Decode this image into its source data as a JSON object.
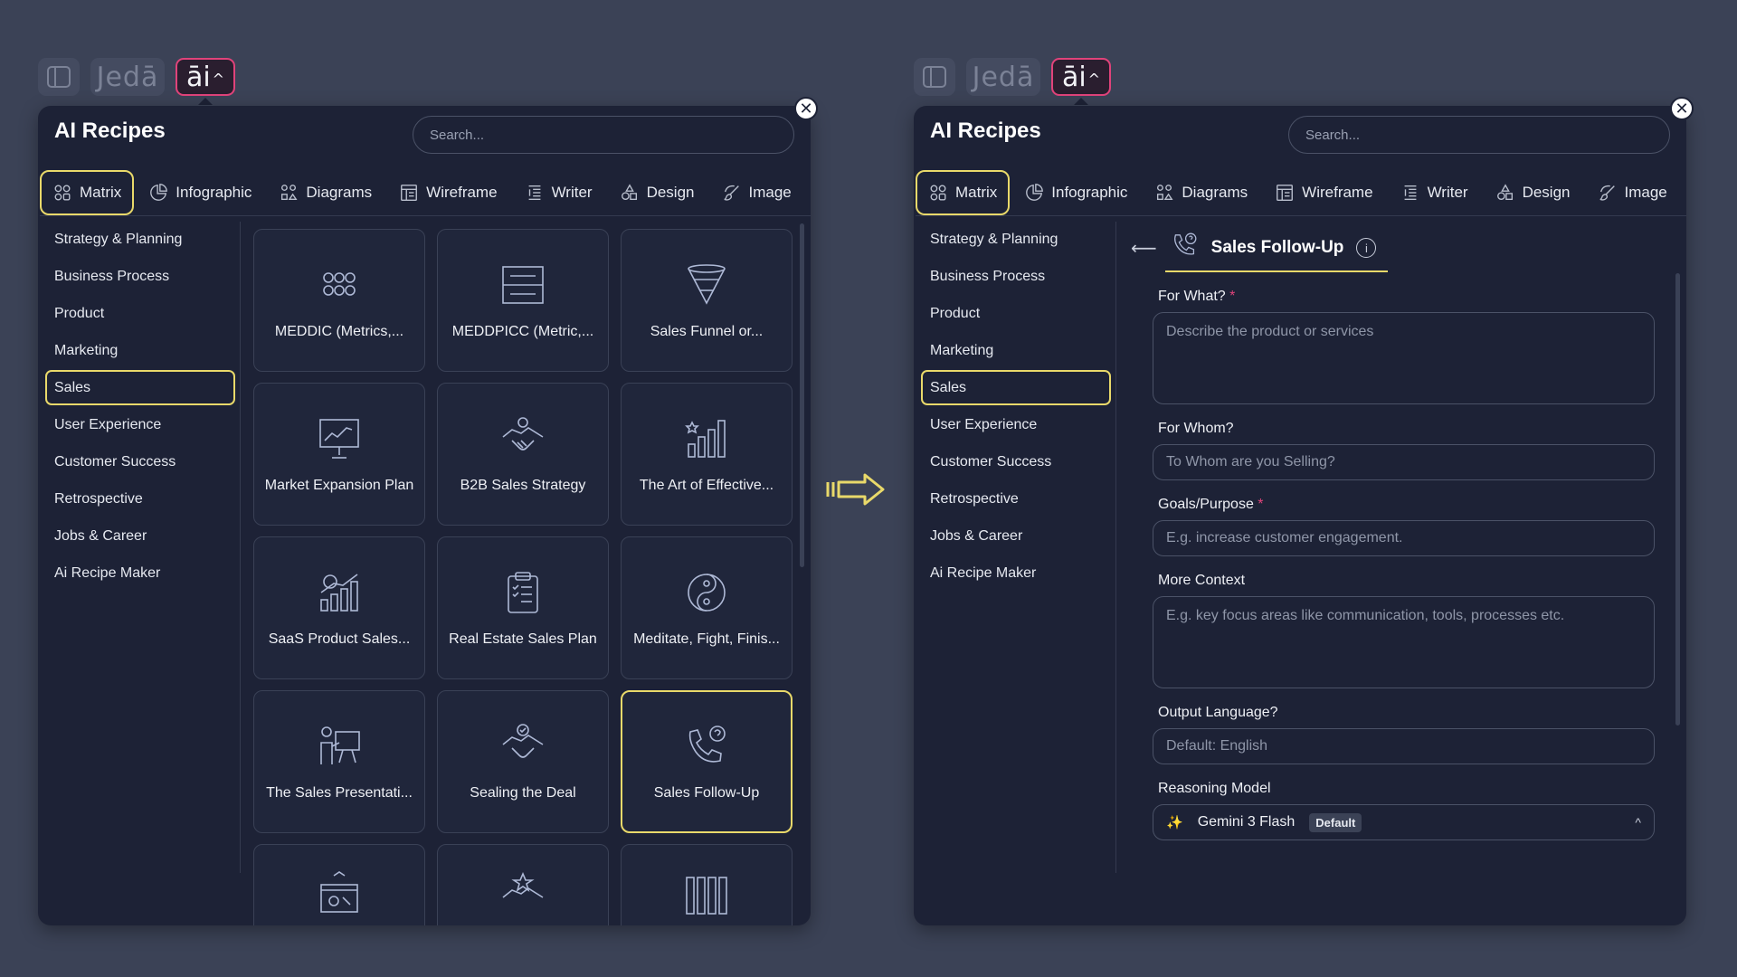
{
  "brand": {
    "jeda_label": "Jedā",
    "ai_label": "āi",
    "ai_chevron": "^"
  },
  "panel": {
    "title": "AI Recipes",
    "search_placeholder": "Search...",
    "close_glyph": "✕"
  },
  "tabs": [
    {
      "label": "Matrix",
      "icon": "grid-icon"
    },
    {
      "label": "Infographic",
      "icon": "pie-chart-icon"
    },
    {
      "label": "Diagrams",
      "icon": "diagram-icon"
    },
    {
      "label": "Wireframe",
      "icon": "wireframe-icon"
    },
    {
      "label": "Writer",
      "icon": "writer-icon"
    },
    {
      "label": "Design",
      "icon": "shapes-icon"
    },
    {
      "label": "Image",
      "icon": "brush-icon"
    }
  ],
  "categories": [
    "Strategy & Planning",
    "Business Process",
    "Product",
    "Marketing",
    "Sales",
    "User Experience",
    "Customer Success",
    "Retrospective",
    "Jobs & Career",
    "Ai Recipe Maker"
  ],
  "active_category": "Sales",
  "recipes": [
    {
      "label": "MEDDIC (Metrics,...",
      "icon": "meddic-icon"
    },
    {
      "label": "MEDDPICC (Metric,...",
      "icon": "meddpicc-icon"
    },
    {
      "label": "Sales Funnel or...",
      "icon": "funnel-icon"
    },
    {
      "label": "Market Expansion Plan",
      "icon": "presentation-chart-icon"
    },
    {
      "label": "B2B Sales Strategy",
      "icon": "handshake-icon"
    },
    {
      "label": "The Art of Effective...",
      "icon": "bar-chart-stars-icon"
    },
    {
      "label": "SaaS Product Sales...",
      "icon": "growth-chart-icon"
    },
    {
      "label": "Real Estate Sales Plan",
      "icon": "clipboard-icon"
    },
    {
      "label": "Meditate, Fight, Finis...",
      "icon": "yin-yang-icon"
    },
    {
      "label": "The Sales Presentati...",
      "icon": "presenter-icon"
    },
    {
      "label": "Sealing the Deal",
      "icon": "handshake-check-icon"
    },
    {
      "label": "Sales Follow-Up",
      "icon": "phone-question-icon"
    },
    {
      "label": "",
      "icon": "board-icon"
    },
    {
      "label": "",
      "icon": "handshake-star-icon"
    },
    {
      "label": "",
      "icon": "columns-icon"
    }
  ],
  "selected_recipe": "Sales Follow-Up",
  "form": {
    "back_glyph": "⟵",
    "title": "Sales Follow-Up",
    "info_glyph": "i",
    "fields": [
      {
        "label": "For What?",
        "required": true,
        "placeholder": "Describe the product or services",
        "type": "area"
      },
      {
        "label": "For Whom?",
        "required": false,
        "placeholder": "To Whom are you Selling?",
        "type": "text"
      },
      {
        "label": "Goals/Purpose",
        "required": true,
        "placeholder": "E.g. increase customer engagement.",
        "type": "text"
      },
      {
        "label": "More Context",
        "required": false,
        "placeholder": "E.g. key focus areas like communication, tools, processes etc.",
        "type": "area"
      },
      {
        "label": "Output Language?",
        "required": false,
        "placeholder": "Default: English",
        "type": "text"
      }
    ],
    "required_mark": "*",
    "model_label": "Reasoning Model",
    "model_value": "Gemini 3 Flash",
    "model_badge": "Default",
    "model_spark": "✨",
    "model_caret": "^"
  },
  "colors": {
    "background": "#3b4256",
    "panel": "#1d2236",
    "accent_yellow": "#e9d96a",
    "accent_pink": "#e0437a"
  }
}
